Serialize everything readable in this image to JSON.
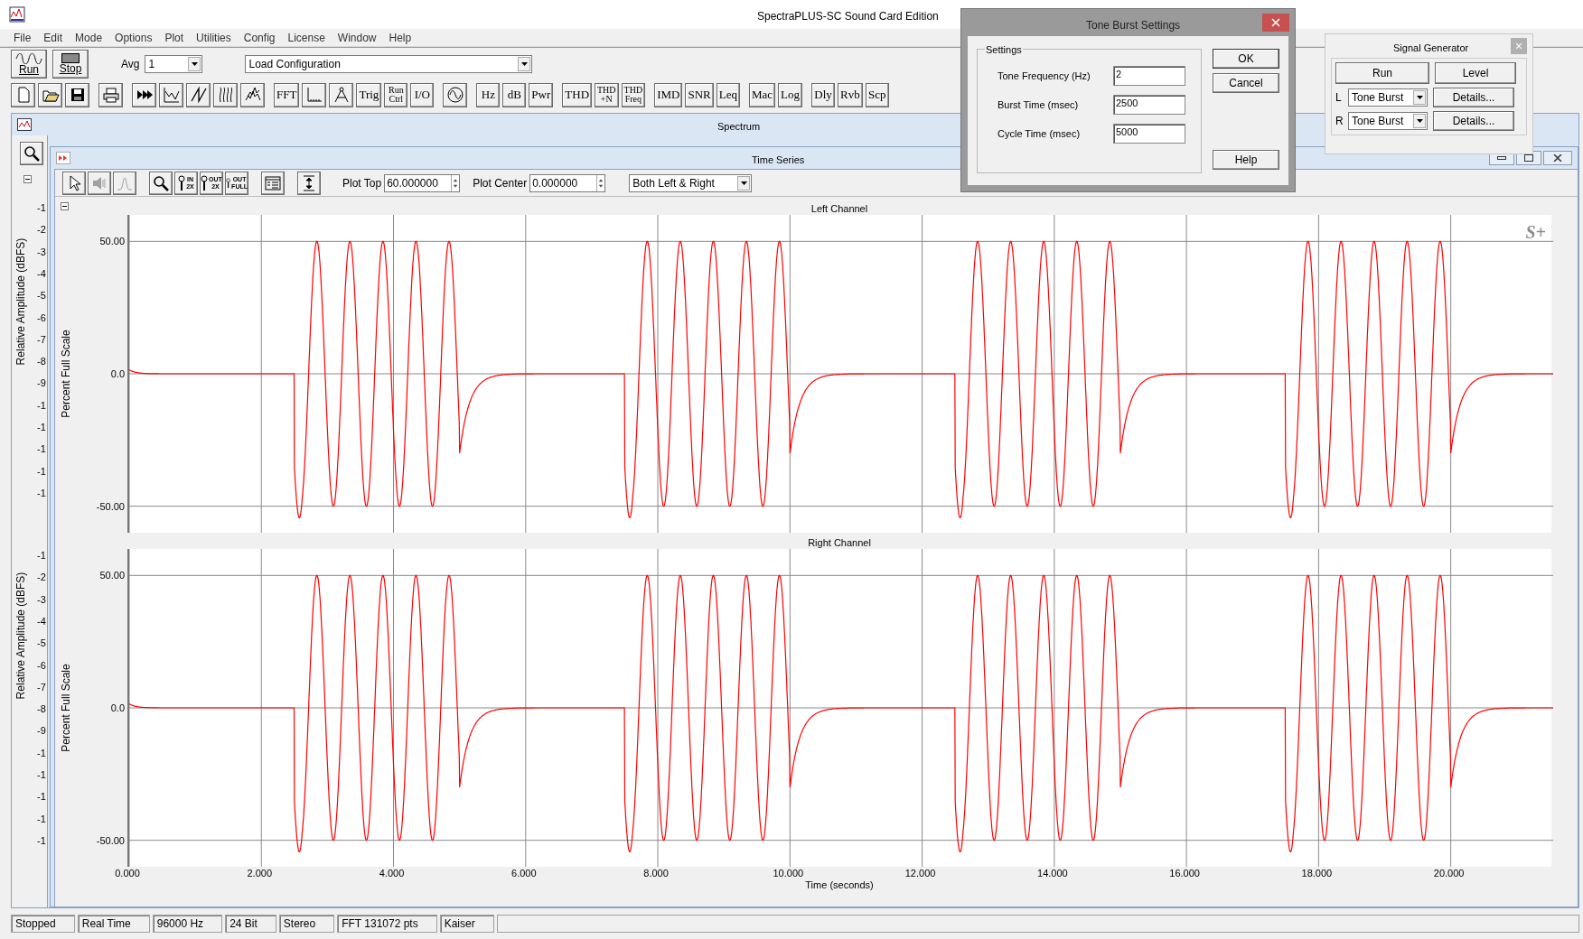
{
  "app": {
    "title": "SpectraPLUS-SC Sound Card Edition"
  },
  "menu": [
    "File",
    "Edit",
    "Mode",
    "Options",
    "Plot",
    "Utilities",
    "Config",
    "License",
    "Window",
    "Help"
  ],
  "transport": [
    {
      "kind": "run",
      "label": "Run"
    },
    {
      "kind": "stop",
      "label": "Stop"
    }
  ],
  "avg": {
    "label": "Avg",
    "value": "1"
  },
  "config": {
    "value": "Load Configuration"
  },
  "toolbar_groups": [
    [
      {
        "kind": "new"
      },
      {
        "kind": "open"
      },
      {
        "kind": "save"
      }
    ],
    [
      {
        "kind": "print"
      }
    ],
    [
      {
        "kind": "forward"
      },
      {
        "kind": "graph"
      },
      {
        "kind": "sawtooth"
      },
      {
        "kind": "spectrogram"
      },
      {
        "kind": "waterfall"
      }
    ],
    [
      {
        "kind": "text",
        "lines": [
          "FFT"
        ]
      },
      {
        "kind": "axes"
      },
      {
        "kind": "compass"
      },
      {
        "kind": "text",
        "lines": [
          "Trig"
        ]
      },
      {
        "kind": "text",
        "lines": [
          "Run",
          "Ctrl"
        ]
      },
      {
        "kind": "text",
        "lines": [
          "I/O"
        ]
      }
    ],
    [
      {
        "kind": "sine"
      }
    ],
    [
      {
        "kind": "text",
        "lines": [
          "Hz"
        ]
      },
      {
        "kind": "text",
        "lines": [
          "dB"
        ]
      },
      {
        "kind": "text",
        "lines": [
          "Pwr"
        ]
      }
    ],
    [
      {
        "kind": "text",
        "lines": [
          "THD"
        ]
      },
      {
        "kind": "text",
        "lines": [
          "THD",
          "+N"
        ]
      },
      {
        "kind": "text",
        "lines": [
          "THD",
          "Freq"
        ]
      }
    ],
    [
      {
        "kind": "text",
        "lines": [
          "IMD"
        ]
      },
      {
        "kind": "text",
        "lines": [
          "SNR"
        ]
      },
      {
        "kind": "text",
        "lines": [
          "Leq"
        ]
      }
    ],
    [
      {
        "kind": "text",
        "lines": [
          "Mac"
        ]
      },
      {
        "kind": "text",
        "lines": [
          "Log"
        ]
      }
    ],
    [
      {
        "kind": "text",
        "lines": [
          "Dly"
        ]
      },
      {
        "kind": "text",
        "lines": [
          "Rvb"
        ]
      },
      {
        "kind": "text",
        "lines": [
          "Scp"
        ]
      }
    ]
  ],
  "spectrum_window": {
    "title": "Spectrum",
    "panels": [
      {
        "ylabel": "Relative Amplitude (dBFS)",
        "ticks": [
          "-1",
          "-2",
          "-3",
          "-4",
          "-5",
          "-6",
          "-7",
          "-8",
          "-9",
          "-1",
          "-1",
          "-1",
          "-1",
          "-1"
        ]
      },
      {
        "ylabel": "Relative Amplitude (dBFS)",
        "ticks": [
          "-1",
          "-2",
          "-3",
          "-4",
          "-5",
          "-6",
          "-7",
          "-8",
          "-9",
          "-1",
          "-1",
          "-1",
          "-1",
          "-1"
        ]
      }
    ]
  },
  "time_series": {
    "title": "Time Series",
    "tool_groups": [
      [
        {
          "kind": "pointer",
          "disabled": false
        },
        {
          "kind": "speaker",
          "disabled": true
        },
        {
          "kind": "peak",
          "disabled": true
        }
      ],
      [
        {
          "kind": "zoom",
          "disabled": false
        },
        {
          "kind": "zoomtext",
          "lines": [
            "IN",
            "2X"
          ],
          "disabled": false
        },
        {
          "kind": "zoomtext",
          "lines": [
            "OUT",
            "2X"
          ],
          "disabled": false
        },
        {
          "kind": "zoomtext",
          "lines": [
            "OUT",
            "FULL"
          ],
          "disabled": false
        }
      ],
      [
        {
          "kind": "legend",
          "disabled": false
        }
      ],
      [
        {
          "kind": "fit",
          "disabled": false
        }
      ]
    ],
    "plot_top": {
      "label": "Plot Top",
      "value": "60.000000"
    },
    "plot_center": {
      "label": "Plot Center",
      "value": "0.000000"
    },
    "channel_select": "Both Left & Right",
    "channels": [
      {
        "title": "Left Channel",
        "ylabel": "Percent Full Scale",
        "yticks": [
          "50.00",
          "0.0",
          "-50.00"
        ],
        "logo": "S+"
      },
      {
        "title": "Right Channel",
        "ylabel": "Percent Full Scale",
        "yticks": [
          "50.00",
          "0.0",
          "-50.00"
        ]
      }
    ],
    "xticks": [
      "0.000",
      "2.000",
      "4.000",
      "6.000",
      "8.000",
      "10.000",
      "12.000",
      "14.000",
      "16.000",
      "18.000",
      "20.000"
    ],
    "xlabel": "Time (seconds)"
  },
  "tone_burst_dialog": {
    "title": "Tone Burst Settings",
    "group": "Settings",
    "fields": [
      {
        "label": "Tone Frequency (Hz)",
        "value": "2"
      },
      {
        "label": "Burst Time (msec)",
        "value": "2500"
      },
      {
        "label": "Cycle Time (msec)",
        "value": "5000"
      }
    ],
    "buttons": [
      "OK",
      "Cancel",
      "Help"
    ]
  },
  "signal_generator": {
    "title": "Signal Generator",
    "buttons": [
      "Run",
      "Level"
    ],
    "channels": [
      {
        "label": "L",
        "waveform": "Tone Burst",
        "button": "Details..."
      },
      {
        "label": "R",
        "waveform": "Tone Burst",
        "button": "Details..."
      }
    ]
  },
  "status_bar": [
    "Stopped",
    "Real Time",
    "96000 Hz",
    "24 Bit",
    "Stereo",
    "FFT 131072 pts",
    "Kaiser"
  ]
}
